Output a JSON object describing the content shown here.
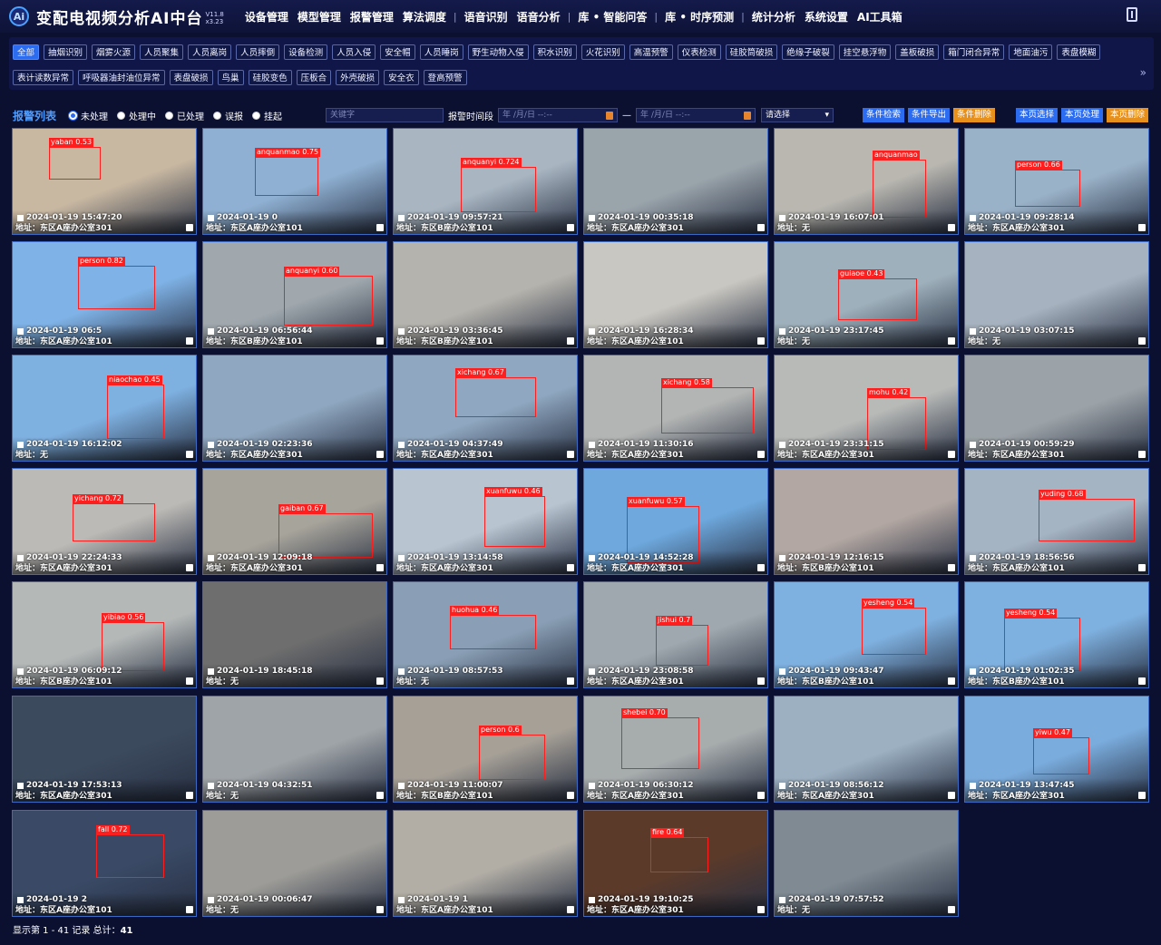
{
  "app": {
    "title": "变配电视频分析AI中台",
    "version_top": "V11.8",
    "version_bottom": "x3.23"
  },
  "nav": {
    "items": [
      "设备管理",
      "模型管理",
      "报警管理",
      "算法调度",
      "语音识别",
      "语音分析",
      "库 • 智能问答",
      "库 • 时序预测",
      "统计分析",
      "系统设置",
      "AI工具箱"
    ]
  },
  "categories": {
    "row1": [
      "全部",
      "抽烟识别",
      "烟雾火源",
      "人员聚集",
      "人员离岗",
      "人员摔倒",
      "设备检测",
      "人员入侵",
      "安全帽",
      "人员睡岗",
      "野生动物入侵",
      "积水识别",
      "火花识别",
      "高温预警",
      "仪表检测",
      "硅胶筒破损",
      "绝缘子破裂",
      "挂空悬浮物",
      "盖板破损",
      "箱门闭合异常",
      "地面油污",
      "表盘模糊"
    ],
    "row2": [
      "表计读数异常",
      "呼吸器油封油位异常",
      "表盘破损",
      "鸟巢",
      "硅胶变色",
      "压板合",
      "外壳破损",
      "安全衣",
      "登高预警"
    ]
  },
  "filter": {
    "title": "报警列表",
    "statuses": [
      "未处理",
      "处理中",
      "已处理",
      "误报",
      "挂起"
    ],
    "keyword_placeholder": "关键字",
    "time_label": "报警时间段",
    "date_placeholder": "年 /月/日  --:--",
    "range_sep": "—",
    "select_default": "请选择",
    "buttons": [
      "条件检索",
      "条件导出",
      "条件删除",
      "本页选择",
      "本页处理",
      "本页删除"
    ],
    "colors": {
      "blue": "#2c6cf0",
      "orange": "#e8901c"
    }
  },
  "alarms": [
    {
      "ts": "2024-01-19 15:47:20",
      "addr": "地址：东区A座办公室301",
      "label": "yaban 0.53",
      "bg": "#c8b8a2"
    },
    {
      "ts": "2024-01-19 0",
      "addr": "地址：东区A座办公室101",
      "label": "anquanmao 0.75",
      "bg": "#8fb0d2"
    },
    {
      "ts": "2024-01-19 09:57:21",
      "addr": "地址：东区B座办公室101",
      "label": "anquanyi 0.724",
      "bg": "#a9b6c2"
    },
    {
      "ts": "2024-01-19 00:35:18",
      "addr": "地址：东区A座办公室301",
      "label": "",
      "bg": "#9aa4ab"
    },
    {
      "ts": "2024-01-19 16:07:01",
      "addr": "地址：无",
      "label": "anquanmao",
      "bg": "#b9b7b0"
    },
    {
      "ts": "2024-01-19 09:28:14",
      "addr": "地址：东区A座办公室301",
      "label": "person 0.66",
      "bg": "#9ab2c8"
    },
    {
      "ts": "2024-01-19 06:5",
      "addr": "地址：东区A座办公室101",
      "label": "person 0.82",
      "bg": "#7fb2e6"
    },
    {
      "ts": "2024-01-19 06:56:44",
      "addr": "地址：东区B座办公室101",
      "label": "anquanyi 0.60",
      "bg": "#a0a8ae"
    },
    {
      "ts": "2024-01-19 03:36:45",
      "addr": "地址：东区B座办公室101",
      "label": "",
      "bg": "#b5b3ad"
    },
    {
      "ts": "2024-01-19 16:28:34",
      "addr": "地址：东区A座办公室101",
      "label": "",
      "bg": "#c9c7c1"
    },
    {
      "ts": "2024-01-19 23:17:45",
      "addr": "地址：无",
      "label": "guiaoe 0.43",
      "bg": "#9eb0bb"
    },
    {
      "ts": "2024-01-19 03:07:15",
      "addr": "地址：无",
      "label": "",
      "bg": "#a6b2bf"
    },
    {
      "ts": "2024-01-19 16:12:02",
      "addr": "地址：无",
      "label": "niaochao 0.45",
      "bg": "#7eb0e0"
    },
    {
      "ts": "2024-01-19 02:23:36",
      "addr": "地址：东区A座办公室301",
      "label": "",
      "bg": "#8fa7c0"
    },
    {
      "ts": "2024-01-19 04:37:49",
      "addr": "地址：东区A座办公室301",
      "label": "xichang 0.67",
      "bg": "#8fa7c0"
    },
    {
      "ts": "2024-01-19 11:30:16",
      "addr": "地址：东区A座办公室301",
      "label": "xichang 0.58",
      "bg": "#b3b5b4"
    },
    {
      "ts": "2024-01-19 23:31:15",
      "addr": "地址：东区A座办公室301",
      "label": "mohu 0.42",
      "bg": "#b8bab8"
    },
    {
      "ts": "2024-01-19 00:59:29",
      "addr": "地址：东区A座办公室301",
      "label": "",
      "bg": "#9ca3a8"
    },
    {
      "ts": "2024-01-19 22:24:33",
      "addr": "地址：东区A座办公室301",
      "label": "yichang 0.72",
      "bg": "#bcbab6"
    },
    {
      "ts": "2024-01-19 12:09:18",
      "addr": "地址：东区A座办公室301",
      "label": "gaiban 0.67",
      "bg": "#a7a49b"
    },
    {
      "ts": "2024-01-19 13:14:58",
      "addr": "地址：东区A座办公室301",
      "label": "xuanfuwu 0.46",
      "bg": "#b8c4d0"
    },
    {
      "ts": "2024-01-19 14:52:28",
      "addr": "地址：东区A座办公室301",
      "label": "xuanfuwu 0.57",
      "bg": "#6ea8dd"
    },
    {
      "ts": "2024-01-19 12:16:15",
      "addr": "地址：东区B座办公室101",
      "label": "",
      "bg": "#b2a7a2"
    },
    {
      "ts": "2024-01-19 18:56:56",
      "addr": "地址：东区A座办公室101",
      "label": "yuding 0.68",
      "bg": "#a5b4c3"
    },
    {
      "ts": "2024-01-19 06:09:12",
      "addr": "地址：东区B座办公室101",
      "label": "yibiao 0.56",
      "bg": "#b4b8b7"
    },
    {
      "ts": "2024-01-19 18:45:18",
      "addr": "地址：无",
      "label": "",
      "bg": "#6e6e6e"
    },
    {
      "ts": "2024-01-19 08:57:53",
      "addr": "地址：无",
      "label": "huohua 0.46",
      "bg": "#8a9fb5"
    },
    {
      "ts": "2024-01-19 23:08:58",
      "addr": "地址：东区A座办公室301",
      "label": "jishui 0.7",
      "bg": "#9fa8ae"
    },
    {
      "ts": "2024-01-19 09:43:47",
      "addr": "地址：东区B座办公室101",
      "label": "yesheng 0.54",
      "bg": "#7fb1e0"
    },
    {
      "ts": "2024-01-19 01:02:35",
      "addr": "地址：东区B座办公室101",
      "label": "yesheng 0.54",
      "bg": "#7fb1e0"
    },
    {
      "ts": "2024-01-19 17:53:13",
      "addr": "地址：东区A座办公室301",
      "label": "",
      "bg": "#3c4a5e"
    },
    {
      "ts": "2024-01-19 04:32:51",
      "addr": "地址：无",
      "label": "",
      "bg": "#9fa4a8"
    },
    {
      "ts": "2024-01-19 11:00:07",
      "addr": "地址：东区B座办公室101",
      "label": "person 0.6",
      "bg": "#a6a097"
    },
    {
      "ts": "2024-01-19 06:30:12",
      "addr": "地址：东区A座办公室301",
      "label": "shebei 0.70",
      "bg": "#a7acad"
    },
    {
      "ts": "2024-01-19 08:56:12",
      "addr": "地址：东区A座办公室301",
      "label": "",
      "bg": "#9cb0c2"
    },
    {
      "ts": "2024-01-19 13:47:45",
      "addr": "地址：东区A座办公室301",
      "label": "yiwu 0.47",
      "bg": "#7aacdd"
    },
    {
      "ts": "2024-01-19 2",
      "addr": "地址：东区A座办公室101",
      "label": "fall 0.72",
      "bg": "#3a4a66"
    },
    {
      "ts": "2024-01-19 00:06:47",
      "addr": "地址：无",
      "label": "",
      "bg": "#9d9c98"
    },
    {
      "ts": "2024-01-19 1",
      "addr": "地址：东区A座办公室101",
      "label": "",
      "bg": "#b2aea6"
    },
    {
      "ts": "2024-01-19 19:10:25",
      "addr": "地址：东区A座办公室301",
      "label": "fire 0.64",
      "bg": "#5b3a2a"
    },
    {
      "ts": "2024-01-19 07:57:52",
      "addr": "地址：无",
      "label": "",
      "bg": "#7f8a93"
    }
  ],
  "footer": {
    "text": "显示第 1 - 41 记录 总计：",
    "total": "41"
  }
}
